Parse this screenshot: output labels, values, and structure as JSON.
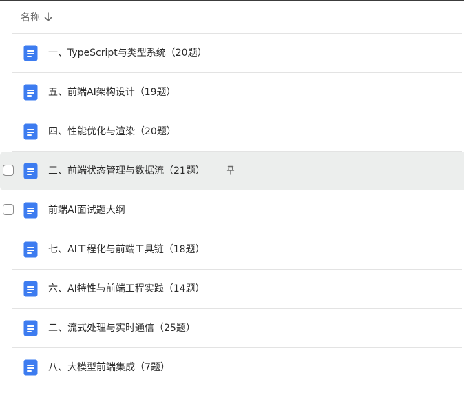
{
  "header": {
    "column_label": "名称",
    "sort_icon": "arrow-down-icon"
  },
  "rows": [
    {
      "title": "一、TypeScript与类型系统（20题）",
      "icon": "document-icon",
      "checkbox": false,
      "pinned": false,
      "highlighted": false
    },
    {
      "title": "五、前端AI架构设计（19题）",
      "icon": "document-icon",
      "checkbox": false,
      "pinned": false,
      "highlighted": false
    },
    {
      "title": "四、性能优化与渲染（20题）",
      "icon": "document-icon",
      "checkbox": false,
      "pinned": false,
      "highlighted": false
    },
    {
      "title": "三、前端状态管理与数据流（21题）",
      "icon": "document-icon",
      "checkbox": true,
      "pinned": true,
      "highlighted": true
    },
    {
      "title": "前端AI面试题大纲",
      "icon": "document-icon",
      "checkbox": true,
      "pinned": false,
      "highlighted": false
    },
    {
      "title": "七、AI工程化与前端工具链（18题）",
      "icon": "document-icon",
      "checkbox": false,
      "pinned": false,
      "highlighted": false
    },
    {
      "title": "六、AI特性与前端工程实践（14题）",
      "icon": "document-icon",
      "checkbox": false,
      "pinned": false,
      "highlighted": false
    },
    {
      "title": "二、流式处理与实时通信（25题）",
      "icon": "document-icon",
      "checkbox": false,
      "pinned": false,
      "highlighted": false
    },
    {
      "title": "八、大模型前端集成（7题）",
      "icon": "document-icon",
      "checkbox": false,
      "pinned": false,
      "highlighted": false
    }
  ],
  "colors": {
    "doc_icon": "#3d7cf0",
    "hover_row": "#eceeed",
    "divider": "#e3e3e3"
  }
}
